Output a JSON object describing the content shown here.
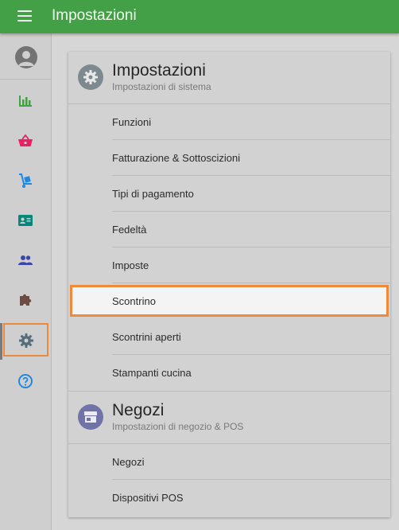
{
  "appbar": {
    "title": "Impostazioni",
    "menu_icon": "hamburger-menu-icon",
    "color": "#43a047"
  },
  "sidebar": {
    "avatar_icon": "user-avatar-icon",
    "items": [
      {
        "icon": "bar-chart-icon",
        "color": "#43a047",
        "active": false
      },
      {
        "icon": "shopping-basket-icon",
        "color": "#e91e63",
        "active": false
      },
      {
        "icon": "hand-truck-icon",
        "color": "#1e88e5",
        "active": false
      },
      {
        "icon": "contact-card-icon",
        "color": "#00897b",
        "active": false
      },
      {
        "icon": "people-icon",
        "color": "#3949ab",
        "active": false
      },
      {
        "icon": "puzzle-piece-icon",
        "color": "#6d4c41",
        "active": false
      },
      {
        "icon": "gear-icon",
        "color": "#546e7a",
        "active": true
      },
      {
        "icon": "help-circle-icon",
        "color": "#1e88e5",
        "active": false
      }
    ],
    "highlight_color": "#ee8a3a"
  },
  "sections": {
    "settings": {
      "title": "Impostazioni",
      "subtitle": "Impostazioni di sistema",
      "icon": "gear-icon",
      "items": [
        "Funzioni",
        "Fatturazione & Sottoscizioni",
        "Tipi di pagamento",
        "Fedeltà",
        "Imposte",
        "Scontrino",
        "Scontrini aperti",
        "Stampanti cucina"
      ],
      "selected": "Scontrino"
    },
    "stores": {
      "title": "Negozi",
      "subtitle": "Impostazioni di negozio & POS",
      "icon": "store-icon",
      "items": [
        "Negozi",
        "Dispositivi POS"
      ]
    }
  }
}
